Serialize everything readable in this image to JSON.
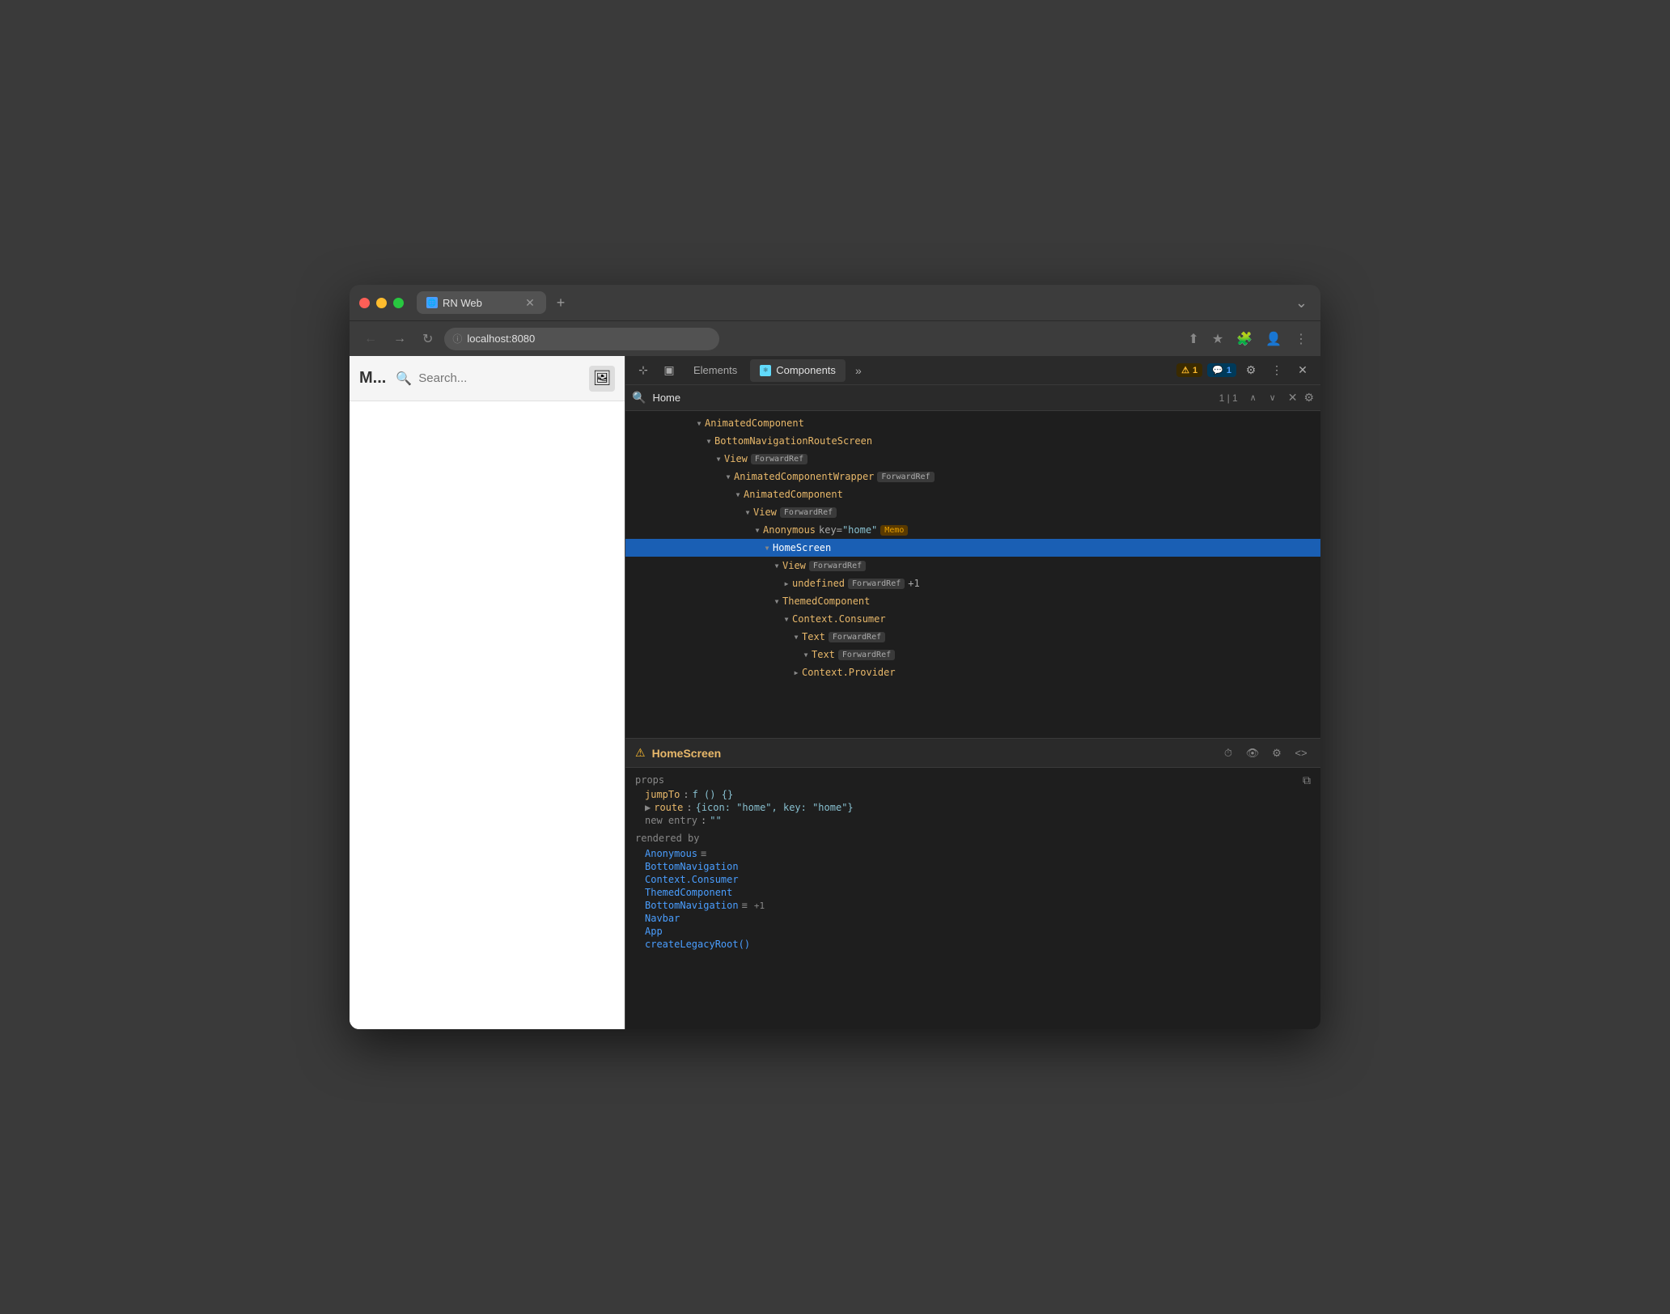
{
  "browser": {
    "tab": {
      "title": "RN Web",
      "favicon": "🌐"
    },
    "address": "localhost:8080",
    "new_tab_label": "+",
    "more_label": "⌄"
  },
  "navbar": {
    "back_label": "←",
    "forward_label": "→",
    "refresh_label": "↻",
    "lock_label": "🔒",
    "share_label": "⬆",
    "bookmark_label": "★",
    "extension_label": "🧩",
    "account_label": "👤",
    "menu_label": "⋮"
  },
  "viewport": {
    "logo": "M...",
    "search_placeholder": "Search...",
    "action_icon": "🖼"
  },
  "devtools": {
    "toolbar": {
      "cursor_icon": "⊹",
      "responsive_icon": "▣",
      "elements_label": "Elements",
      "components_label": "Components",
      "more_label": "»",
      "warn_count": "1",
      "info_count": "1",
      "settings_label": "⚙",
      "kebab_label": "⋮",
      "close_label": "✕"
    },
    "search": {
      "query": "Home",
      "counter": "1 | 1",
      "prev_label": "∧",
      "next_label": "∨",
      "close_label": "✕",
      "settings_label": "⚙"
    },
    "tree": {
      "items": [
        {
          "indent": 6,
          "expanded": true,
          "name": "AnimatedComponent",
          "badges": [],
          "attrs": [],
          "highlight": false
        },
        {
          "indent": 7,
          "expanded": true,
          "name": "BottomNavigationRouteScreen",
          "badges": [],
          "attrs": [],
          "highlight": false
        },
        {
          "indent": 8,
          "expanded": true,
          "name": "View",
          "badges": [
            "ForwardRef"
          ],
          "attrs": [],
          "highlight": false
        },
        {
          "indent": 9,
          "expanded": true,
          "name": "AnimatedComponentWrapper",
          "badges": [
            "ForwardRef"
          ],
          "attrs": [],
          "highlight": false
        },
        {
          "indent": 10,
          "expanded": true,
          "name": "AnimatedComponent",
          "badges": [],
          "attrs": [],
          "highlight": false
        },
        {
          "indent": 11,
          "expanded": true,
          "name": "View",
          "badges": [
            "ForwardRef"
          ],
          "attrs": [],
          "highlight": false
        },
        {
          "indent": 12,
          "expanded": true,
          "name": "Anonymous",
          "badges": [],
          "attr_key": "key=",
          "attr_val": "\"home\"",
          "badge_extra": "Memo",
          "highlight": false
        },
        {
          "indent": 13,
          "expanded": true,
          "name": "HomeScreen",
          "badges": [],
          "attrs": [],
          "highlight": true,
          "selected": true
        },
        {
          "indent": 14,
          "expanded": true,
          "name": "View",
          "badges": [
            "ForwardRef"
          ],
          "attrs": [],
          "highlight": false
        },
        {
          "indent": 15,
          "expanded": false,
          "name": "undefined",
          "badges": [
            "ForwardRef"
          ],
          "attr_plus": "+1",
          "highlight": false
        },
        {
          "indent": 14,
          "expanded": true,
          "name": "ThemedComponent",
          "badges": [],
          "attrs": [],
          "highlight": false
        },
        {
          "indent": 15,
          "expanded": true,
          "name": "Context.Consumer",
          "badges": [],
          "attrs": [],
          "highlight": false
        },
        {
          "indent": 16,
          "expanded": true,
          "name": "Text",
          "badges": [
            "ForwardRef"
          ],
          "attrs": [],
          "highlight": false
        },
        {
          "indent": 17,
          "expanded": true,
          "name": "Text",
          "badges": [
            "ForwardRef"
          ],
          "attrs": [],
          "highlight": false
        },
        {
          "indent": 16,
          "expanded": false,
          "name": "Context.Provider",
          "badges": [],
          "attrs": [],
          "highlight": false
        }
      ]
    },
    "component_detail": {
      "name": "HomeScreen",
      "props_label": "props",
      "props": [
        {
          "key": "jumpTo",
          "colon": ":",
          "val": "f () {}",
          "type": "code"
        },
        {
          "key": "route",
          "colon": ":",
          "val": "{icon: \"home\", key: \"home\"}",
          "type": "object",
          "expandable": true
        },
        {
          "key": "new entry",
          "colon": ":",
          "val": "\"\"",
          "type": "string"
        }
      ],
      "rendered_by_label": "rendered by",
      "rendered_by": [
        {
          "name": "Anonymous",
          "eq": true,
          "plus": false,
          "plus_count": ""
        },
        {
          "name": "BottomNavigation",
          "eq": false,
          "plus": false,
          "plus_count": ""
        },
        {
          "name": "Context.Consumer",
          "eq": false,
          "plus": false,
          "plus_count": ""
        },
        {
          "name": "ThemedComponent",
          "eq": false,
          "plus": false,
          "plus_count": ""
        },
        {
          "name": "BottomNavigation",
          "eq": true,
          "plus": true,
          "plus_count": "+1"
        },
        {
          "name": "Navbar",
          "eq": false,
          "plus": false,
          "plus_count": ""
        },
        {
          "name": "App",
          "eq": false,
          "plus": false,
          "plus_count": ""
        },
        {
          "name": "createLegacyRoot()",
          "eq": false,
          "plus": false,
          "plus_count": ""
        }
      ]
    }
  }
}
